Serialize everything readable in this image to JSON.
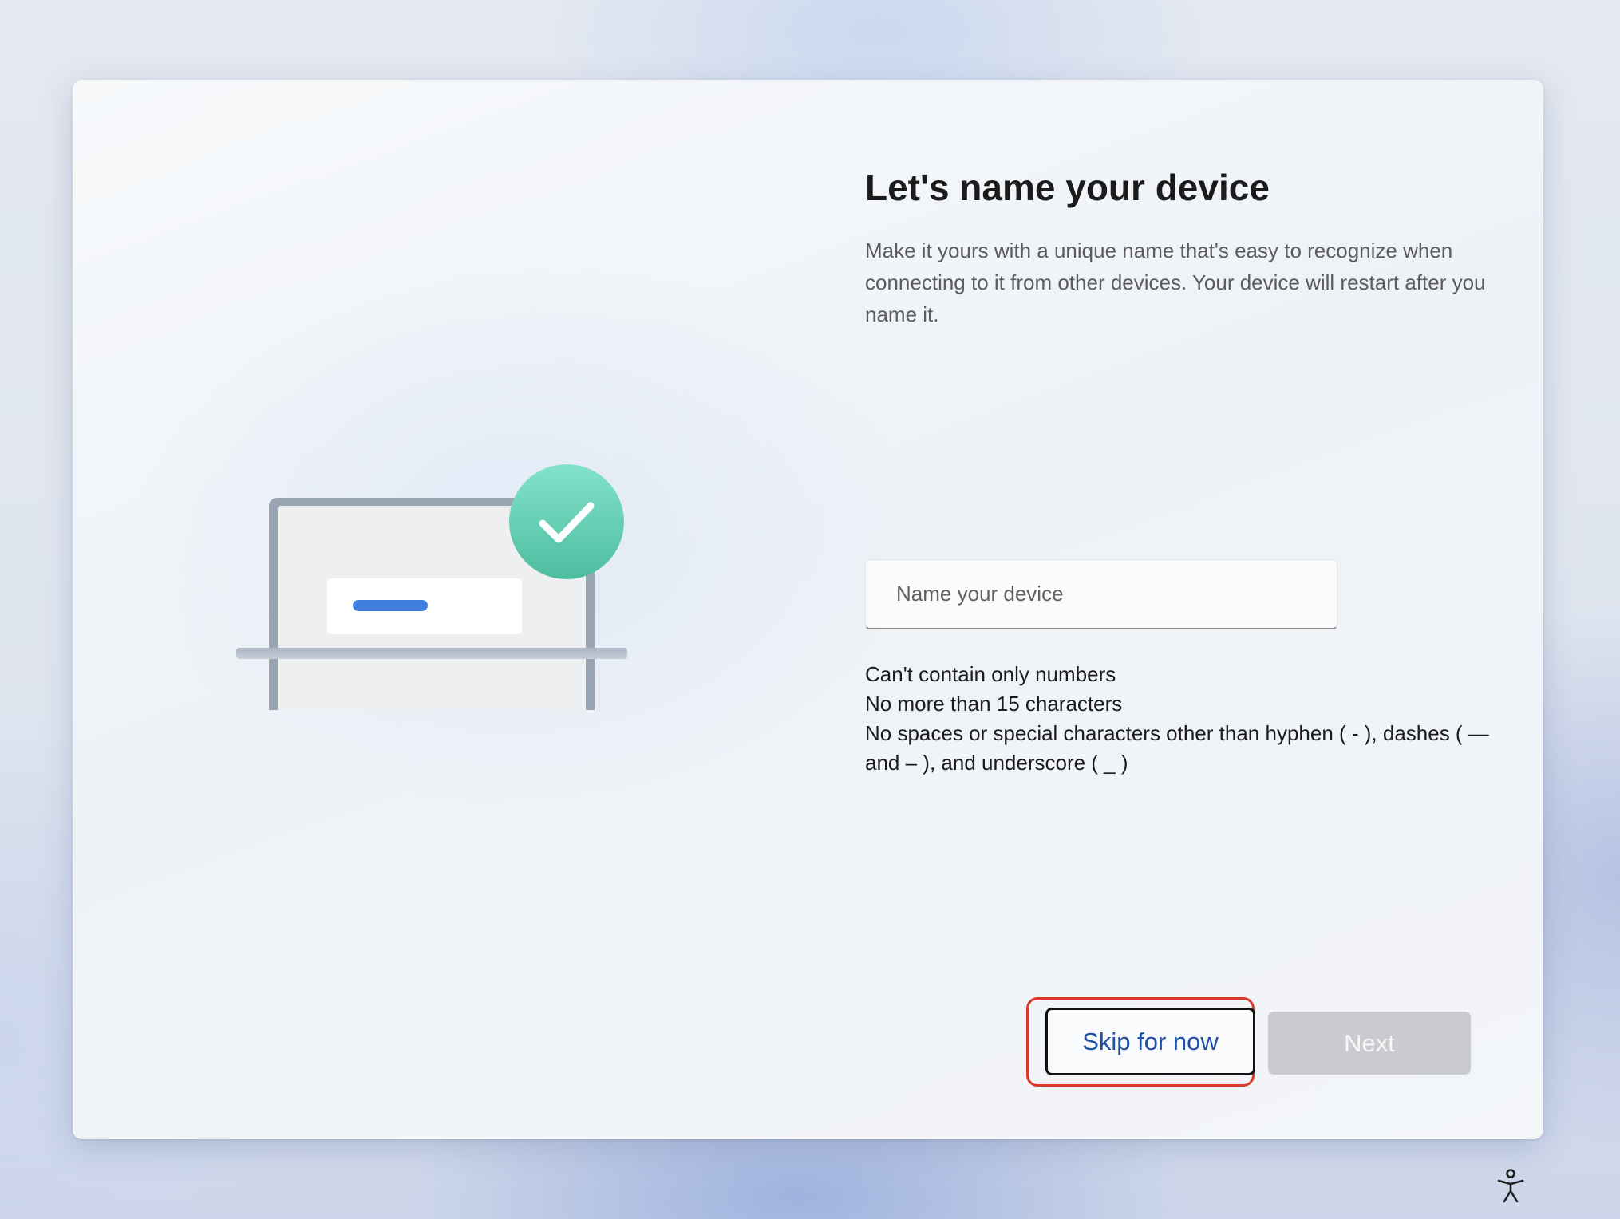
{
  "page": {
    "title": "Let's name your device",
    "description": "Make it yours with a unique name that's easy to recognize when connecting to it from other devices. Your device will restart after you name it.",
    "input": {
      "placeholder": "Name your device",
      "value": ""
    },
    "rules": [
      "Can't contain only numbers",
      "No more than 15 characters",
      "No spaces or special characters other than hyphen ( - ), dashes ( — and – ), and underscore ( _ )"
    ]
  },
  "buttons": {
    "skip_label": "Skip for now",
    "next_label": "Next"
  },
  "icons": {
    "illustration": "laptop-checkmark-illustration",
    "checkmark": "checkmark-icon",
    "accessibility": "accessibility-icon"
  },
  "colors": {
    "title": "#1b1b1b",
    "description": "#5c5c5c",
    "skip_text": "#1d4fa3",
    "next_disabled_bg": "#c9cbce",
    "check_badge": "#5fd0b3",
    "laptop_bar": "#3f7fde",
    "highlight": "#d93a2b"
  }
}
